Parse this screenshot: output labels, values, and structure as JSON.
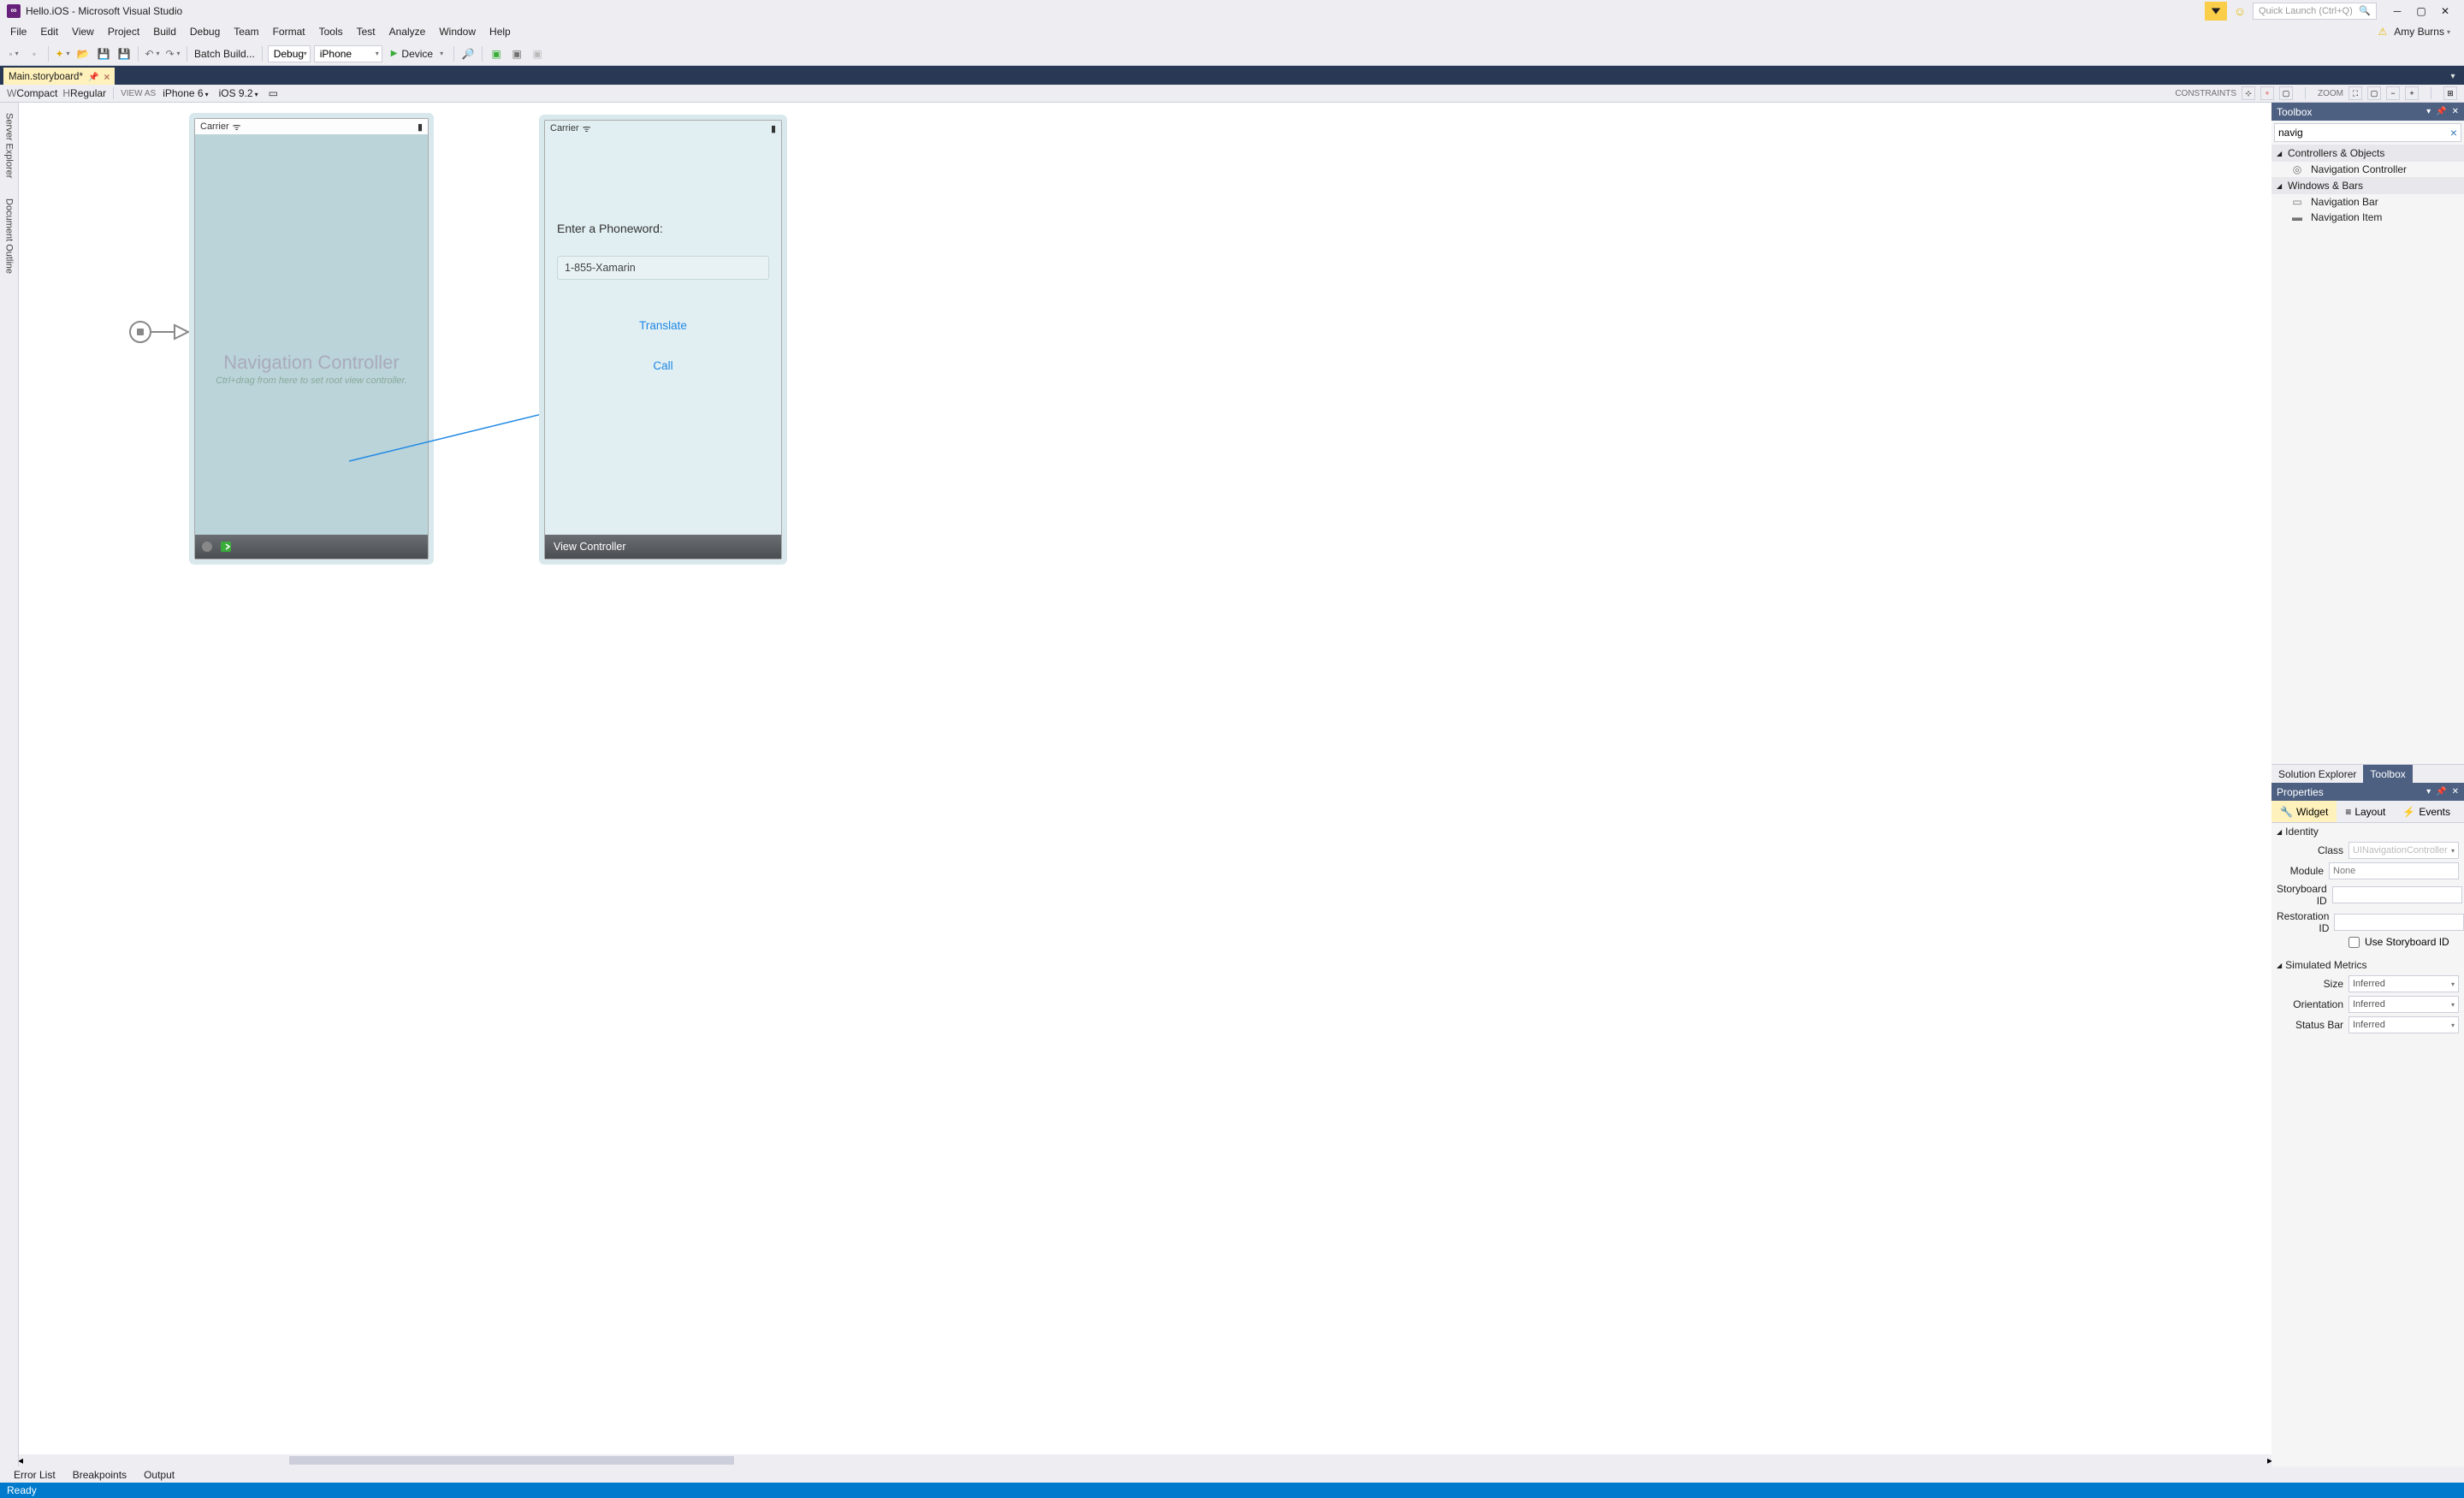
{
  "titlebar": {
    "title": "Hello.iOS - Microsoft Visual Studio",
    "quick_launch_placeholder": "Quick Launch (Ctrl+Q)",
    "user_name": "Amy Burns"
  },
  "menu": [
    "File",
    "Edit",
    "View",
    "Project",
    "Build",
    "Debug",
    "Team",
    "Format",
    "Tools",
    "Test",
    "Analyze",
    "Window",
    "Help"
  ],
  "toolbar": {
    "batch_build": "Batch Build...",
    "config": "Debug",
    "platform": "iPhone",
    "device": "Device"
  },
  "doc_tab": {
    "name": "Main.storyboard*"
  },
  "designbar": {
    "w": "W",
    "compact": "Compact",
    "h": "H",
    "regular": "Regular",
    "viewas": "VIEW AS",
    "device": "iPhone 6",
    "os": "iOS 9.2",
    "constraints": "CONSTRAINTS",
    "zoom": "ZOOM"
  },
  "canvas": {
    "dev1": {
      "carrier": "Carrier",
      "title": "Navigation Controller",
      "sub": "Ctrl+drag from here to set root view controller."
    },
    "dev2": {
      "carrier": "Carrier",
      "label": "Enter a Phoneword:",
      "input": "1-855-Xamarin",
      "translate": "Translate",
      "call": "Call",
      "footer": "View Controller"
    }
  },
  "toolbox": {
    "title": "Toolbox",
    "search": "navig",
    "groups": [
      {
        "name": "Controllers & Objects",
        "items": [
          {
            "icon": "◎",
            "label": "Navigation Controller"
          }
        ]
      },
      {
        "name": "Windows & Bars",
        "items": [
          {
            "icon": "▭",
            "label": "Navigation Bar"
          },
          {
            "icon": "▬",
            "label": "Navigation Item"
          }
        ]
      }
    ]
  },
  "panel_tabs": [
    "Solution Explorer",
    "Toolbox"
  ],
  "properties": {
    "title": "Properties",
    "tabs": [
      "Widget",
      "Layout",
      "Events"
    ],
    "identity": {
      "label": "Identity",
      "class": "Class",
      "class_placeholder": "UINavigationController",
      "module": "Module",
      "module_placeholder": "None",
      "storyboard_id": "Storyboard ID",
      "restoration_id": "Restoration ID",
      "use_sb": "Use Storyboard ID"
    },
    "simulated": {
      "label": "Simulated Metrics",
      "size": "Size",
      "orientation": "Orientation",
      "status_bar": "Status Bar",
      "inferred": "Inferred"
    }
  },
  "bottom_tabs": [
    "Error List",
    "Breakpoints",
    "Output"
  ],
  "status": "Ready"
}
